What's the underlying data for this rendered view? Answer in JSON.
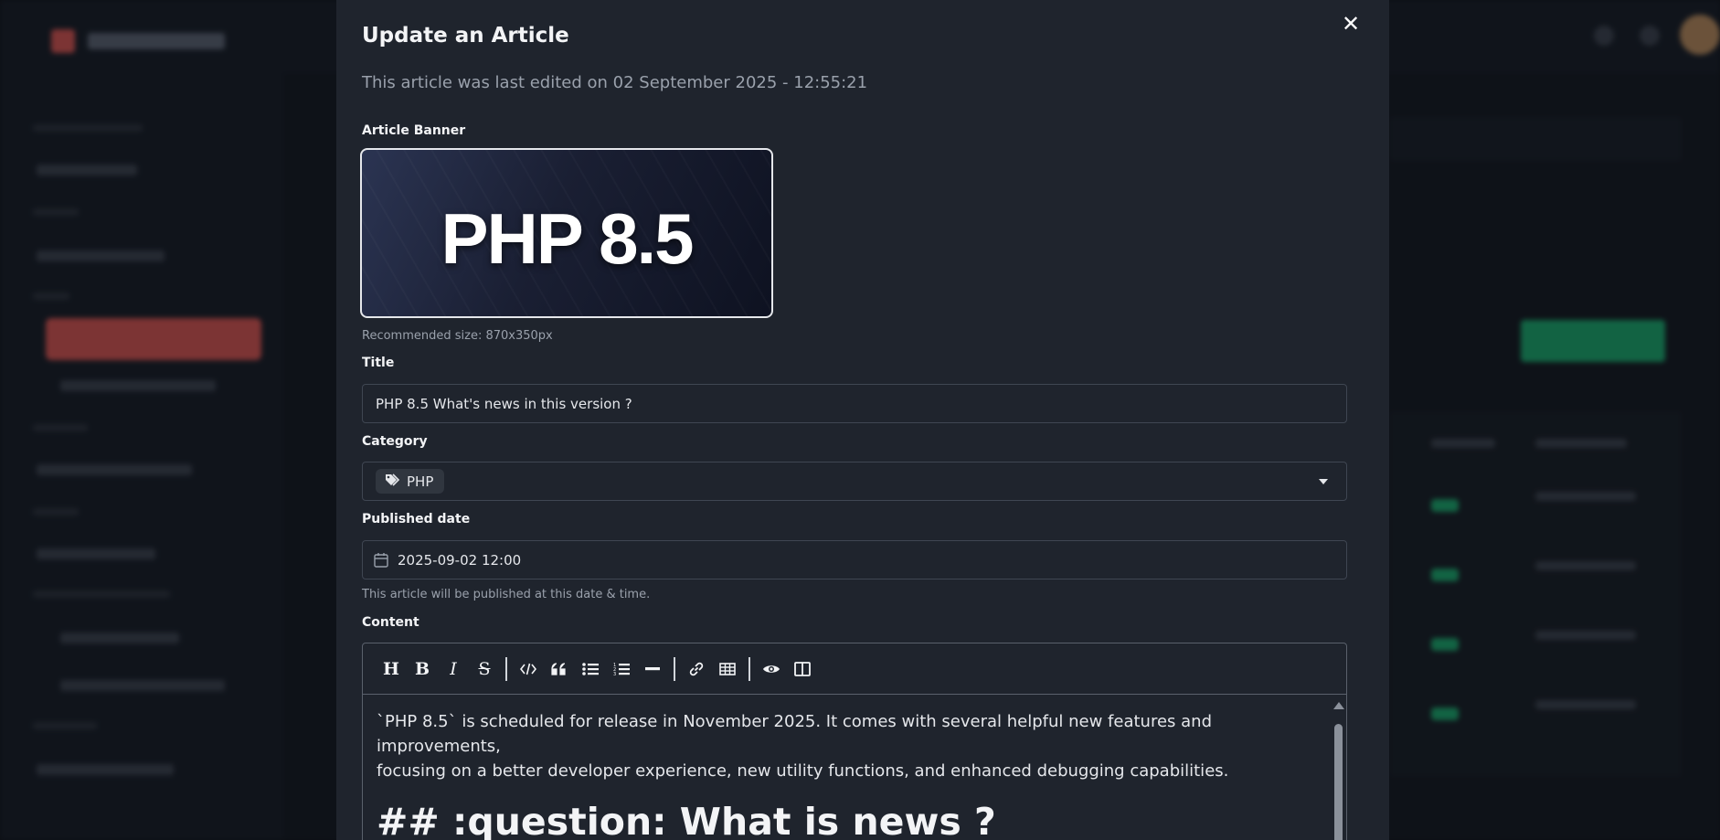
{
  "modal": {
    "title": "Update an Article",
    "close_icon": "close-icon",
    "subtitle": "This article was last edited on 02 September 2025 - 12:55:21",
    "banner": {
      "label": "Article Banner",
      "image_text": "PHP 8.5",
      "help": "Recommended size: 870x350px"
    },
    "title_field": {
      "label": "Title",
      "value": "PHP 8.5 What's news in this version ?"
    },
    "category_field": {
      "label": "Category",
      "selected": "PHP",
      "tag_icon": "tags-icon"
    },
    "published_field": {
      "label": "Published date",
      "value": "2025-09-02 12:00",
      "icon": "calendar-icon",
      "help": "This article will be published at this date & time."
    },
    "content_field": {
      "label": "Content",
      "toolbar": [
        {
          "name": "heading",
          "icon": "heading-icon"
        },
        {
          "name": "bold",
          "icon": "bold-icon"
        },
        {
          "name": "italic",
          "icon": "italic-icon"
        },
        {
          "name": "strikethrough",
          "icon": "strikethrough-icon"
        },
        {
          "name": "code",
          "icon": "code-icon"
        },
        {
          "name": "quote",
          "icon": "quote-icon"
        },
        {
          "name": "unordered-list",
          "icon": "list-ul-icon"
        },
        {
          "name": "ordered-list",
          "icon": "list-ol-icon"
        },
        {
          "name": "horizontal-rule",
          "icon": "minus-icon"
        },
        {
          "name": "link",
          "icon": "link-icon"
        },
        {
          "name": "table",
          "icon": "table-icon"
        },
        {
          "name": "preview",
          "icon": "eye-icon"
        },
        {
          "name": "side-by-side",
          "icon": "columns-icon"
        }
      ],
      "paragraph_line1": "`PHP 8.5` is scheduled for release in November 2025. It comes with several helpful new features and improvements,",
      "paragraph_line2": "focusing on a better developer experience, new utility functions, and enhanced debugging capabilities.",
      "heading": "## :question: What is news ?"
    }
  },
  "colors": {
    "modal_bg": "#1f242d",
    "page_bg": "#0c0f14",
    "accent_red": "#d9534f",
    "accent_green": "#18a96b",
    "border": "#3f4652"
  }
}
